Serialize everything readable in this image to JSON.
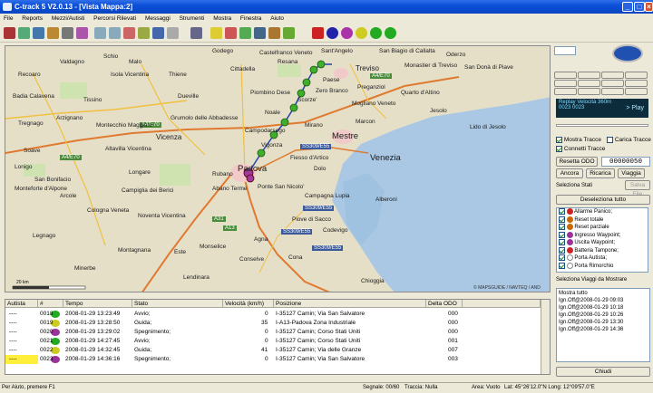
{
  "window": {
    "title": "C-track 5 V2.0.13 - [Vista Mappa:2]"
  },
  "menu": [
    "File",
    "Reports",
    "Mezzi/Autisti",
    "Percorsi Rilevati",
    "Messaggi",
    "Strumenti",
    "Mostra",
    "Finestra",
    "Aiuto"
  ],
  "map": {
    "towns": [
      "Godego",
      "Castelfranco Veneto",
      "Resana",
      "Sant'Angelo",
      "San Biagio di Callalta",
      "Valdagno",
      "Malo",
      "Schio",
      "Thiene",
      "Dueville",
      "Cittadella",
      "Paese",
      "Treviso",
      "Oderzo",
      "Recoaro",
      "Isola Vicentina",
      "Monastier di Treviso",
      "San Donà di Piave",
      "Tissino",
      "Piombino Dese",
      "Preganziol",
      "Badia Calavena",
      "Arzignano",
      "Vicenza",
      "Montecchio Maggiore",
      "Grumolo delle Abbadesse",
      "Zero Branco",
      "Noale",
      "Mogliano Veneto",
      "Jesolo",
      "Lido di Jesolo",
      "Tregnago",
      "Altavilla Vicentina",
      "Mirano",
      "Marcon",
      "Quarto d'Altino",
      "Scorze'",
      "Mestre",
      "Venezia",
      "Lonigo",
      "Campodarsego",
      "Soave",
      "San Bonifacio",
      "Longare",
      "Vigonza",
      "Fiesso d'Artico",
      "Dolo",
      "Padova",
      "Rubano",
      "Monteforte d'Alpone",
      "Campiglia dei Berici",
      "Abano Terme",
      "Ponte San Nicolo'",
      "Campagna Lupia",
      "Chioggia",
      "Arcole",
      "Cologna Veneta",
      "Noventa Vicentina",
      "Agna",
      "Codevigo",
      "Alberoni",
      "Piove di Sacco",
      "Legnago",
      "Montagnana",
      "Este",
      "Monselice",
      "Conselve",
      "Cona",
      "Minerbe",
      "Lendinara"
    ],
    "labels": [
      "A4/E70",
      "A4/E70",
      "A4/E70",
      "A13",
      "A31",
      "SS309/E55",
      "SS309/E55",
      "SS309/E55",
      "SS309/E55"
    ],
    "copyright": "© MAPSGUIDE / NAVTEQ / AND",
    "scale": "20 km"
  },
  "right": {
    "replay": "Replay Velocità  360m",
    "replay_sub": "0023  0023",
    "play": "> Play",
    "mostra_tracce": "Mostra Tracce",
    "carica_tracce": "Carica Tracce",
    "connetti_tracce": "Connetti Tracce",
    "resetta_odo": "Resetta ODO",
    "odo_value": "00000050",
    "ancora": "Ancora",
    "ricarica": "Ricarica",
    "viaggia": "Viaggia",
    "seleziona_stati": "Seleziona Stati",
    "salva_file": "Salva File",
    "deseleziona": "Deseleziona tutto",
    "stati": [
      "Allarme Panico;",
      "Reset totale",
      "Reset parziale",
      "Ingresso Waypoint;",
      "Uscita Waypoint;",
      "Batteria Tampone;",
      "Porta Autista;",
      "Porta Rimorchio"
    ],
    "seleziona_viaggi": "Seleziona Viaggi da Mostrare",
    "viaggi": [
      "Mostra tutto",
      "Ign.Off@2008-01-29 09:03",
      "Ign.Off@2008-01-29 10:18",
      "Ign.Off@2008-01-29 10:26",
      "Ign.Off@2008-01-29 13:30",
      "Ign.Off@2008-01-29 14:36"
    ],
    "chiudi": "Chiudi"
  },
  "table": {
    "headers": [
      "Autista",
      "#",
      "Tempo",
      "Stato",
      "Velocità (km/h)",
      "Posizione",
      "Delta ODO"
    ],
    "rows": [
      {
        "autista": "----",
        "num": "0018",
        "tempo": "2008-01-29 13:23:49",
        "stato": "Avvio;",
        "vel": "0",
        "pos": "I-35127 Camin; Via San Salvatore",
        "odo": "000"
      },
      {
        "autista": "----",
        "num": "0019",
        "tempo": "2008-01-29 13:28:50",
        "stato": "Guida;",
        "vel": "35",
        "pos": "I-A13-Padova Zona Industriale",
        "odo": "000"
      },
      {
        "autista": "----",
        "num": "0020",
        "tempo": "2008-01-29 13:29:02",
        "stato": "Spegnimento;",
        "vel": "0",
        "pos": "I-35127 Camin; Corso Stati Uniti",
        "odo": "000"
      },
      {
        "autista": "----",
        "num": "0021",
        "tempo": "2008-01-29 14:27:45",
        "stato": "Avvio;",
        "vel": "0",
        "pos": "I-35127 Camin; Corso Stati Uniti",
        "odo": "001"
      },
      {
        "autista": "----",
        "num": "0022",
        "tempo": "2008-01-29 14:32:45",
        "stato": "Guida;",
        "vel": "41",
        "pos": "I-35127 Camin; Via delle Granze",
        "odo": "007"
      },
      {
        "autista": "----",
        "num": "0023",
        "tempo": "2008-01-29 14:36:16",
        "stato": "Spegnimento;",
        "vel": "0",
        "pos": "I-35127 Camin; Via San Salvatore",
        "odo": "003"
      }
    ]
  },
  "status": {
    "help": "Per Aiuto, premere F1",
    "segnale": "Segnale: 00/60",
    "traccia": "Traccia: Nulla",
    "area": "Area: Vuoto",
    "coords": "Lat: 45°26'12.0\"N Long: 12°09'57.0\"E"
  },
  "colors": {
    "titlebar": "#0b4fd8",
    "water": "#aac8e4",
    "land": "#e6dfc8",
    "track": "#3fae2a",
    "lcd": "#0c2c3c"
  }
}
